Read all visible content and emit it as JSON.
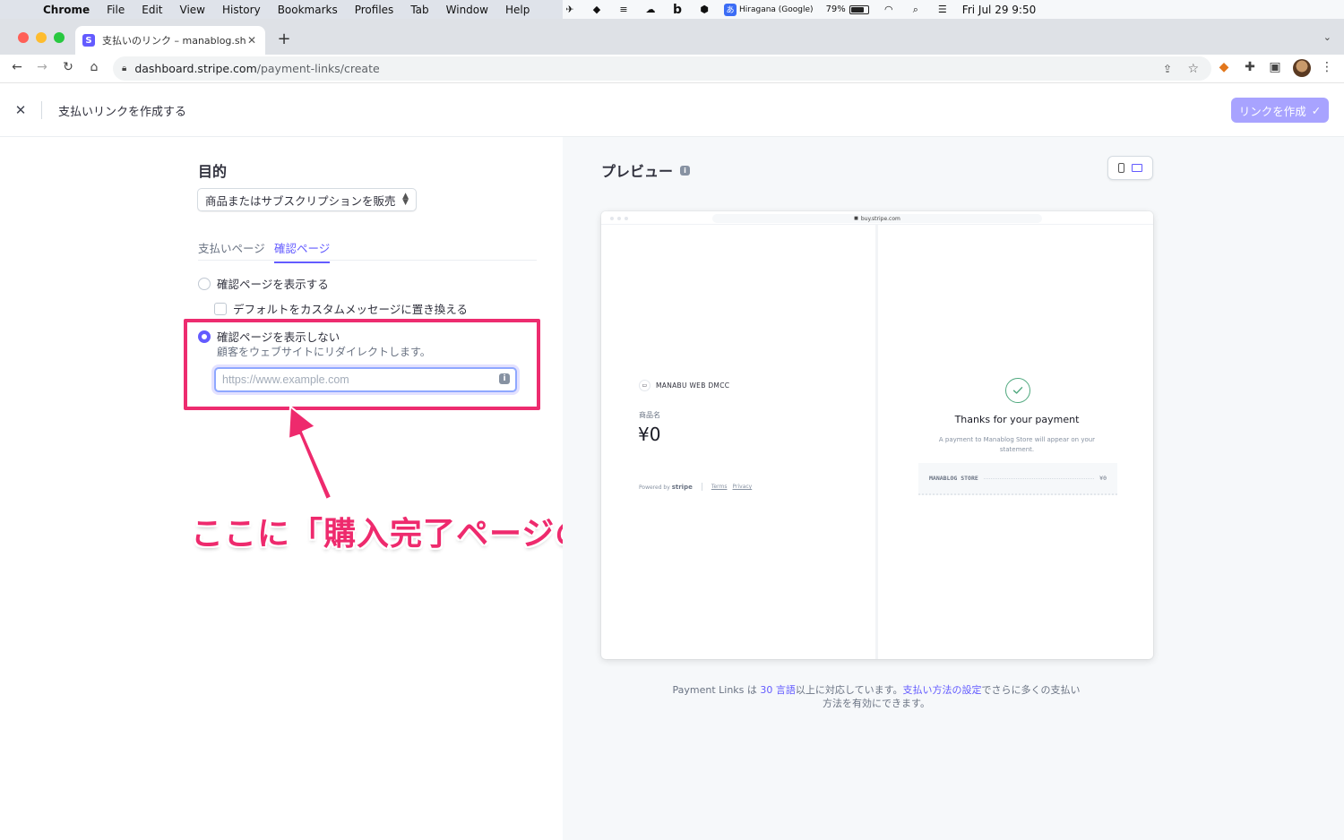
{
  "menubar": {
    "app": "Chrome",
    "items": [
      "File",
      "Edit",
      "View",
      "History",
      "Bookmarks",
      "Profiles",
      "Tab",
      "Window",
      "Help"
    ],
    "ime_label": "Hiragana (Google)",
    "battery": "79%",
    "battery_level": 0.79,
    "clock": "Fri Jul 29  9:50"
  },
  "browser": {
    "tab_title": "支払いのリンク – manablog.shop",
    "url_host": "dashboard.stripe.com",
    "url_path": "/payment-links/create"
  },
  "header": {
    "title": "支払いリンクを作成する",
    "create_button": "リンクを作成"
  },
  "form": {
    "section_title": "目的",
    "purpose_select": "商品またはサブスクリプションを販売",
    "tabs": [
      "支払いページ",
      "確認ページ"
    ],
    "active_tab": 1,
    "option_show": "確認ページを表示する",
    "option_custom_message": "デフォルトをカスタムメッセージに置き換える",
    "option_hide": "確認ページを表示しない",
    "option_hide_sub": "顧客をウェブサイトにリダイレクトします。",
    "url_placeholder": "https://www.example.com",
    "url_value": ""
  },
  "annotation": {
    "text": "ここに「購入完了ページのURL」を入力する",
    "color": "#ed2c6f"
  },
  "preview": {
    "title": "プレビュー",
    "url": "buy.stripe.com",
    "merchant": "MANABU WEB DMCC",
    "product_label": "商品名",
    "price": "¥0",
    "powered_by": "Powered by",
    "stripe_wordmark": "stripe",
    "terms": "Terms",
    "privacy": "Privacy",
    "thanks": "Thanks for your payment",
    "statement": "A payment to Manablog Store will appear on your statement.",
    "receipt_name": "MANABLOG STORE",
    "receipt_amount": "¥0"
  },
  "footnote": {
    "prefix": "Payment Links は",
    "lang_link": "30 言語",
    "middle": "以上に対応しています。",
    "settings_link": "支払い方法の設定",
    "suffix": "でさらに多くの支払い方法を有効にできます。"
  },
  "colors": {
    "accent": "#635bff",
    "button_disabled": "#a8a3ff",
    "success": "#4fa87e"
  }
}
